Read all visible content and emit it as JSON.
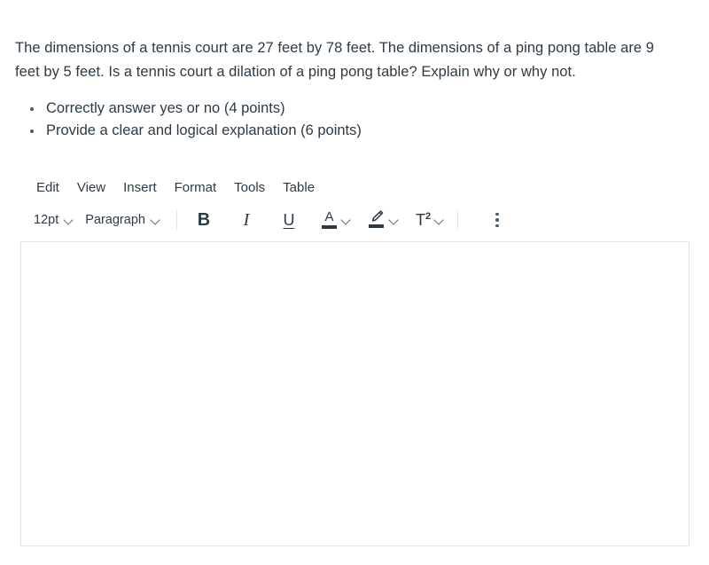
{
  "question": {
    "prompt": "The dimensions of a tennis court are 27 feet by 78 feet. The dimensions of a ping pong table are 9 feet by 5 feet. Is a tennis court a dilation of a ping pong table? Explain why or why not.",
    "criteria": [
      "Correctly answer yes or no (4 points)",
      "Provide a clear and logical explanation (6 points)"
    ]
  },
  "editor": {
    "menubar": [
      {
        "label": "Edit",
        "name": "menu-edit"
      },
      {
        "label": "View",
        "name": "menu-view"
      },
      {
        "label": "Insert",
        "name": "menu-insert"
      },
      {
        "label": "Format",
        "name": "menu-format"
      },
      {
        "label": "Tools",
        "name": "menu-tools"
      },
      {
        "label": "Table",
        "name": "menu-table"
      }
    ],
    "toolbar": {
      "font_size": "12pt",
      "block_format": "Paragraph",
      "bold_label": "B",
      "italic_label": "I",
      "underline_label": "U",
      "text_color_label": "A",
      "superscript_label": "T",
      "superscript_exponent": "2",
      "text_color_swatch": "#2b3a45",
      "highlight_color_swatch": "#2b3a45",
      "more_label": "⋮"
    },
    "content": {
      "value": "",
      "placeholder": ""
    }
  },
  "colors": {
    "text": "#2d3b45",
    "icon": "#2b3a45",
    "border": "#e3e6e8",
    "divider": "#dfe3e6",
    "background": "#ffffff"
  }
}
